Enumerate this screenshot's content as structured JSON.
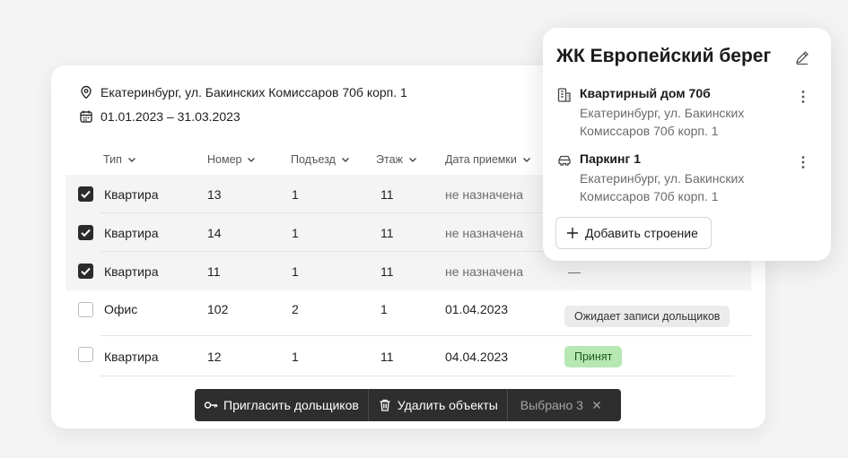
{
  "project": {
    "address": "Екатеринбург, ул. Бакинских Комиссаров 70б корп. 1",
    "date_range": "01.01.2023  – 31.03.2023"
  },
  "table": {
    "columns": [
      "Тип",
      "Номер",
      "Подъезд",
      "Этаж",
      "Дата приемки"
    ],
    "rows": [
      {
        "checked": true,
        "type": "Квартира",
        "number": "13",
        "entrance": "1",
        "floor": "11",
        "date": "не назначена",
        "status": ""
      },
      {
        "checked": true,
        "type": "Квартира",
        "number": "14",
        "entrance": "1",
        "floor": "11",
        "date": "не назначена",
        "status": ""
      },
      {
        "checked": true,
        "type": "Квартира",
        "number": "11",
        "entrance": "1",
        "floor": "11",
        "date": "не назначена",
        "status": "—"
      },
      {
        "checked": false,
        "type": "Офис",
        "number": "102",
        "entrance": "2",
        "floor": "1",
        "date": "01.04.2023",
        "status": "Ожидает записи дольщиков"
      },
      {
        "checked": false,
        "type": "Квартира",
        "number": "12",
        "entrance": "1",
        "floor": "11",
        "date": "04.04.2023",
        "status": "Принят"
      }
    ]
  },
  "toolbar": {
    "invite_label": "Пригласить дольщиков",
    "delete_label": "Удалить объекты",
    "selected_label": "Выбрано 3"
  },
  "popover": {
    "title": "ЖК Европейский берег",
    "buildings": [
      {
        "name": "Квартирный дом 70б",
        "address": "Екатеринбург, ул. Бакинских Комиссаров 70б корп. 1",
        "icon": "building-icon"
      },
      {
        "name": "Паркинг 1",
        "address": "Екатеринбург, ул. Бакинских Комиссаров 70б корп. 1",
        "icon": "car-icon"
      }
    ],
    "add_label": "Добавить строение"
  },
  "colors": {
    "accent_dark": "#2e2e2e",
    "status_green_bg": "#b7e8b4",
    "status_gray_bg": "#ebebeb"
  }
}
